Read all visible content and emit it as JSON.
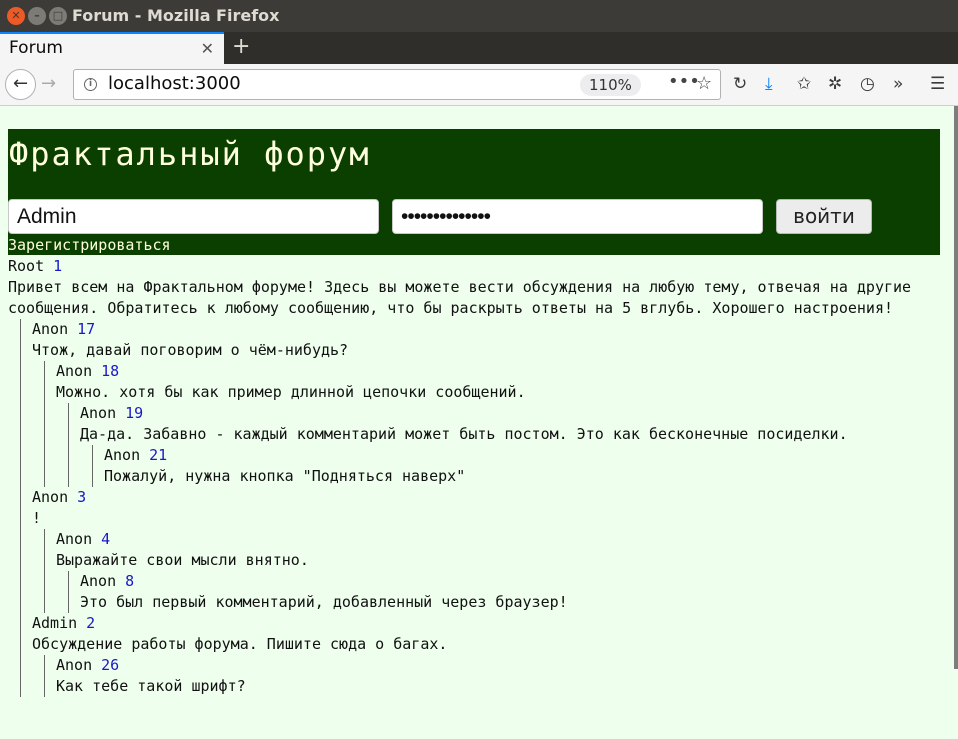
{
  "window": {
    "title": "Forum - Mozilla Firefox"
  },
  "tabs": [
    {
      "label": "Forum"
    }
  ],
  "navbar": {
    "url": "localhost:3000",
    "zoom": "110%",
    "page_actions": "•••"
  },
  "site": {
    "title": "Фрактальный форум",
    "login": {
      "username_value": "Admin",
      "password_value": "••••••••••••••",
      "submit_label": "войти"
    },
    "register_label": "Зарегистрироваться"
  },
  "thread": {
    "root": {
      "author": "Root",
      "num": "1",
      "text": "Привет всем на Фрактальном форуме! Здесь вы можете вести обсуждения на любую тему, отвечая на другие сообщения. Обратитесь к любому сообщению, что бы раскрыть ответы на 5 вглубь. Хорошего настроения!"
    },
    "messages": [
      {
        "author": "Anon",
        "num": "17",
        "text": "Чтож, давай поговорим о чём-нибудь?"
      },
      {
        "author": "Anon",
        "num": "18",
        "text": "Можно. хотя бы как пример длинной цепочки сообщений."
      },
      {
        "author": "Anon",
        "num": "19",
        "text": "Да-да. Забавно - каждый комментарий может быть постом. Это как бесконечные посиделки."
      },
      {
        "author": "Anon",
        "num": "21",
        "text": "Пожалуй, нужна кнопка \"Подняться наверх\""
      },
      {
        "author": "Anon",
        "num": "3",
        "text": "!"
      },
      {
        "author": "Anon",
        "num": "4",
        "text": "Выражайте свои мысли внятно."
      },
      {
        "author": "Anon",
        "num": "8",
        "text": "Это был первый комментарий, добавленный через браузер!"
      },
      {
        "author": "Admin",
        "num": "2",
        "text": "Обсуждение работы форума. Пишите сюда о багах."
      },
      {
        "author": "Anon",
        "num": "26",
        "text": "Как тебе такой шрифт?"
      }
    ]
  },
  "colors": {
    "header_bg": "#0a3f00",
    "page_bg": "#eeffee",
    "header_text": "#ffffdd",
    "msg_num": "#1a18c8"
  }
}
